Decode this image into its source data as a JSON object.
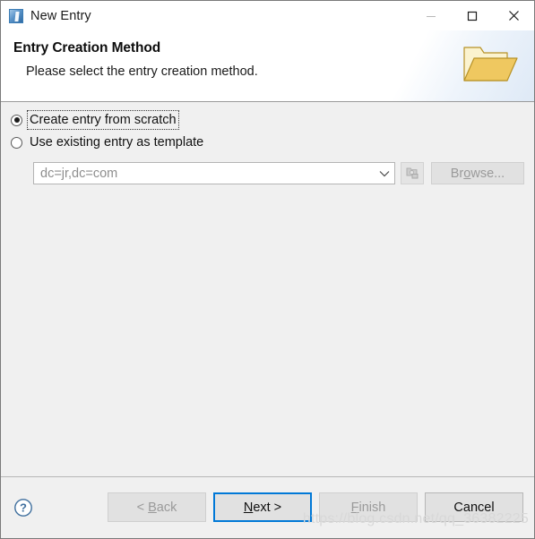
{
  "window": {
    "title": "New Entry",
    "app_icon": "ldap-entry-icon",
    "controls": {
      "minimize": "minimize-icon",
      "maximize": "maximize-icon",
      "close": "close-icon"
    }
  },
  "header": {
    "title": "Entry Creation Method",
    "subtitle": "Please select the entry creation method.",
    "banner_icon": "folder-icon"
  },
  "content": {
    "options": [
      {
        "label": "Create entry from scratch",
        "selected": true,
        "focused": true
      },
      {
        "label": "Use existing entry as template",
        "selected": false,
        "focused": false
      }
    ],
    "template_combo": {
      "value": "dc=jr,dc=com",
      "placeholder": "dc=jr,dc=com",
      "arrow_icon": "chevron-down-icon",
      "enabled": false
    },
    "picker_button": {
      "icon": "folder-picker-icon",
      "enabled": false
    },
    "browse_button": {
      "label": "Browse...",
      "mnemonic": "o",
      "enabled": false
    }
  },
  "footer": {
    "help_icon": "help-question-icon",
    "buttons": [
      {
        "label": "< Back",
        "mnemonic": "B",
        "state": "disabled"
      },
      {
        "label": "Next >",
        "mnemonic": "N",
        "state": "focused"
      },
      {
        "label": "Finish",
        "mnemonic": "F",
        "state": "disabled"
      },
      {
        "label": "Cancel",
        "mnemonic": "",
        "state": "enabled"
      }
    ],
    "watermark": "https://blog.csdn.net/qq_36382225"
  },
  "colors": {
    "accent": "#0078d7",
    "dialog_bg": "#f0f0f0",
    "header_bg": "#ffffff",
    "disabled_text": "#9a9a9a"
  }
}
